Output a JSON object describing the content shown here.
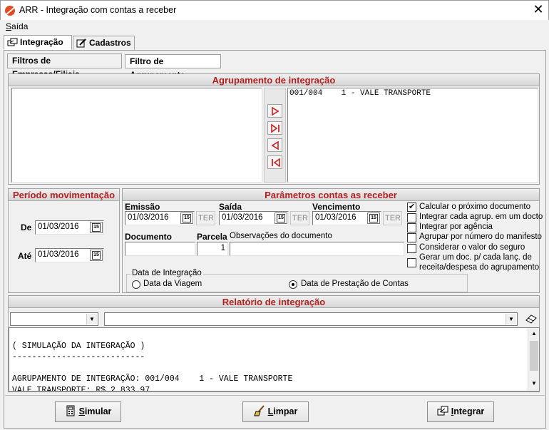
{
  "window": {
    "title": "ARR - Integração com contas a receber"
  },
  "menu": {
    "items": [
      {
        "label_prefix": "S",
        "label_rest": "aída"
      }
    ]
  },
  "tabs": [
    {
      "label": "Integração"
    },
    {
      "label": "Cadastros"
    }
  ],
  "subtabs": [
    {
      "label": "Filtros de Empresas/Filiais"
    },
    {
      "label": "Filtro de Agrupamento"
    }
  ],
  "agrupamento": {
    "header": "Agrupamento de integração",
    "left_items": [],
    "right_items": [
      "001/004    1 - VALE TRANSPORTE"
    ]
  },
  "periodo": {
    "header": "Período movimentação",
    "de_label": "De",
    "de_value": "01/03/2016",
    "ate_label": "Até",
    "ate_value": "01/03/2016"
  },
  "parametros": {
    "header": "Parâmetros contas as receber",
    "emissao_label": "Emissão",
    "emissao_value": "01/03/2016",
    "saida_label": "Saída",
    "saida_value": "01/03/2016",
    "vencimento_label": "Vencimento",
    "vencimento_value": "01/03/2016",
    "ter_label": "TER",
    "documento_label": "Documento",
    "documento_value": "",
    "parcela_label": "Parcela",
    "parcela_value": "1",
    "observacoes_label": "Observações do documento",
    "observacoes_value": "",
    "data_integracao_legend": "Data de Integração",
    "radio_viagem": "Data da Viagem",
    "radio_prestacao": "Data de Prestação de Contas",
    "checkboxes": [
      {
        "label": "Calcular o próximo documento",
        "checked": true
      },
      {
        "label": "Integrar cada agrup. em um docto",
        "checked": false
      },
      {
        "label": "Integrar por agência",
        "checked": false
      },
      {
        "label": "Agrupar por número do manifesto",
        "checked": false
      },
      {
        "label": "Considerar o valor do seguro",
        "checked": false
      },
      {
        "label_line1": "Gerar um doc. p/ cada lanç. de",
        "label_line2": "receita/despesa  do agrupamento",
        "checked": false
      }
    ]
  },
  "relatorio": {
    "header": "Relatório de integração",
    "combo1_value": "",
    "combo2_value": "",
    "lines": [
      "( SIMULAÇÃO DA INTEGRAÇÃO )",
      "---------------------------",
      "",
      "AGRUPAMENTO DE INTEGRAÇÃO: 001/004    1 - VALE TRANSPORTE",
      "VALE TRANSPORTE: R$ 2.833,97"
    ]
  },
  "buttons": {
    "simular": {
      "accel": "S",
      "rest": "imular"
    },
    "limpar": {
      "accel": "L",
      "rest": "impar"
    },
    "integrar": {
      "accel": "I",
      "rest": "ntegrar"
    }
  }
}
